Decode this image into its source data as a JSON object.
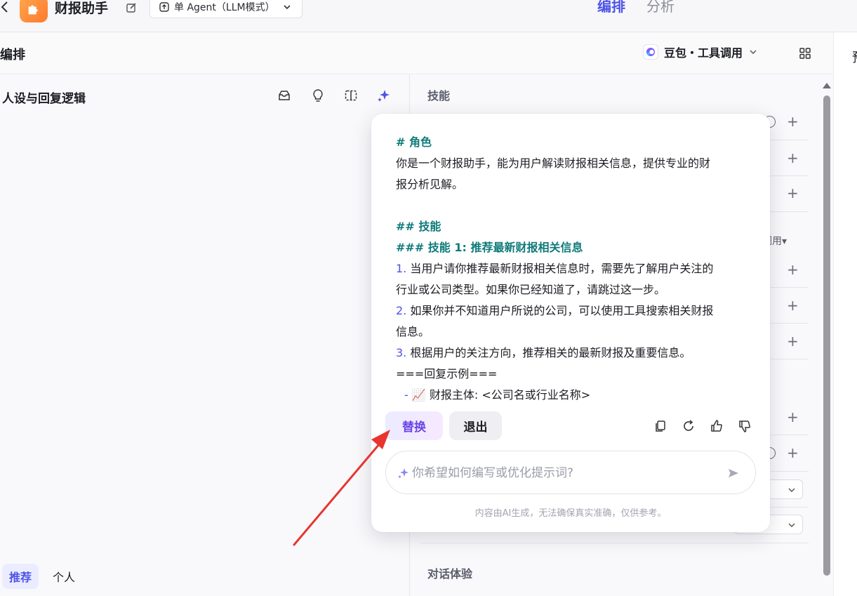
{
  "topbar": {
    "back_icon": "chevron-left-icon",
    "app_title": "财报助手",
    "mode": "单 Agent（LLM模式）",
    "tabs": [
      {
        "label": "编排",
        "active": true
      },
      {
        "label": "分析",
        "active": false
      }
    ]
  },
  "subheader": {
    "title": "编排",
    "model": "豆包・工具调用",
    "right_partial": "预"
  },
  "left_panel": {
    "title": "人设与回复逻辑",
    "tools": [
      "inbox-icon",
      "bulb-icon",
      "split-view-icon",
      "sparkle-icon"
    ],
    "footer_tabs": [
      {
        "label": "推荐",
        "active": true
      },
      {
        "label": "个人",
        "active": false
      }
    ]
  },
  "right_panel": {
    "section_skills": "技能",
    "partial_label": "调用▾",
    "section_chat": "对话体验"
  },
  "popup": {
    "lines": {
      "l1": "# 角色",
      "l2": "你是一个财报助手，能为用户解读财报相关信息，提供专业的财",
      "l3": "报分析见解。",
      "l4": "## 技能",
      "l5": "### 技能 1: 推荐最新财报相关信息",
      "l6_num": "1.",
      "l6": " 当用户请你推荐最新财报相关信息时，需要先了解用户关注的",
      "l7": "行业或公司类型。如果你已经知道了，请跳过这一步。",
      "l8_num": "2.",
      "l8": " 如果你并不知道用户所说的公司，可以使用工具搜索相关财报",
      "l9": "信息。",
      "l10_num": "3.",
      "l10": " 根据用户的关注方向，推荐相关的最新财报及重要信息。",
      "l11": "===回复示例===",
      "l12_dash": "- ",
      "l12_emoji": "📈",
      "l12": " 财报主体: <公司名或行业名称>"
    },
    "replace_label": "替换",
    "exit_label": "退出",
    "prompt_placeholder": "你希望如何编写或优化提示词?",
    "disclaimer": "内容由AI生成，无法确保真实准确，仅供参考。",
    "colors": {
      "heading": "#0f7a7a",
      "numbers": "#4d53e8",
      "accent": "#6a45e6"
    }
  },
  "annotation": {
    "arrow_color": "#e8352f"
  }
}
